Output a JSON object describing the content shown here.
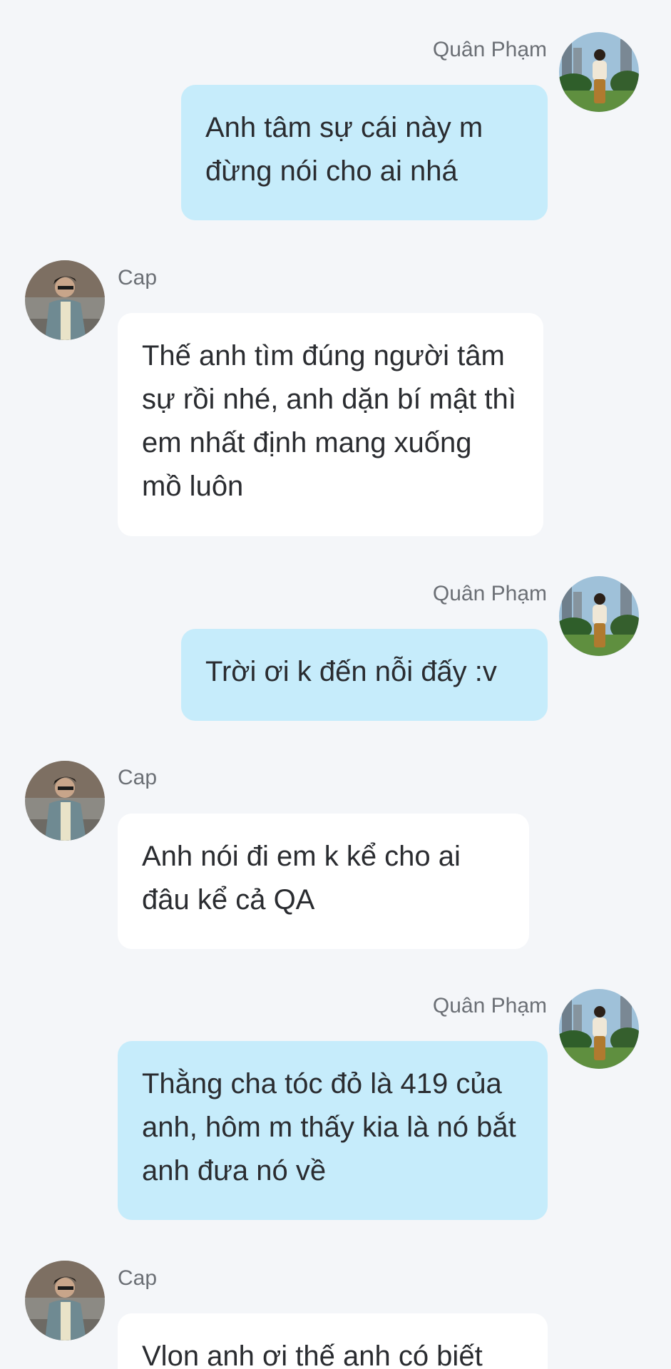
{
  "colors": {
    "background": "#f4f6f9",
    "my_bubble": "#c6ecfb",
    "their_bubble": "#ffffff",
    "name_text": "#6b6f75",
    "message_text": "#2a2c30"
  },
  "participants": {
    "me": {
      "name": "Quân Phạm",
      "avatar_icon": "man-standing-photo-avatar"
    },
    "other": {
      "name": "Cap",
      "avatar_icon": "man-in-jacket-photo-avatar"
    }
  },
  "messages": [
    {
      "sender": "Quân Phạm",
      "text": "Anh tâm sự cái này m đừng nói cho ai nhá"
    },
    {
      "sender": "Cap",
      "text": "Thế anh tìm đúng người tâm sự rồi nhé, anh dặn bí mật thì em nhất định mang xuống mồ luôn"
    },
    {
      "sender": "Quân Phạm",
      "text": "Trời ơi k đến nỗi đấy :v"
    },
    {
      "sender": "Cap",
      "text": "Anh nói đi em k kể cho ai đâu kể cả QA"
    },
    {
      "sender": "Quân Phạm",
      "text": "Thằng cha tóc đỏ là 419 của anh, hôm m thấy kia là nó bắt anh đưa nó về"
    },
    {
      "sender": "Cap",
      "text": "Vlon anh ơi thế anh có biết"
    }
  ]
}
